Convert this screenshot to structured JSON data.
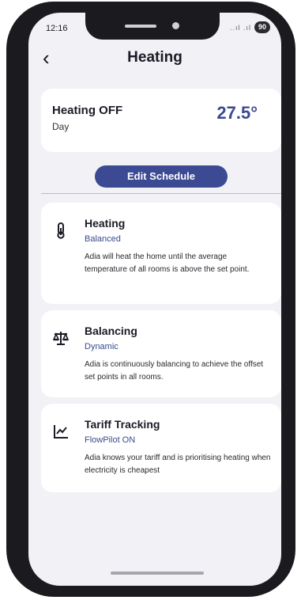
{
  "status_bar": {
    "time": "12:16",
    "signal": "..ıl .ıl",
    "battery": "90"
  },
  "header": {
    "back_glyph": "‹",
    "title": "Heating"
  },
  "summary": {
    "status": "Heating OFF",
    "mode": "Day",
    "temperature": "27.5°"
  },
  "edit_button": "Edit Schedule",
  "cards": [
    {
      "icon": "thermometer-icon",
      "title": "Heating",
      "subtitle": "Balanced",
      "description": "Adia will heat the home until the average temperature of all rooms is above the set point."
    },
    {
      "icon": "scale-icon",
      "title": "Balancing",
      "subtitle": "Dynamic",
      "description": "Adia is continuously balancing to achieve the offset set points in all rooms."
    },
    {
      "icon": "chart-line-icon",
      "title": "Tariff Tracking",
      "subtitle": "FlowPilot ON",
      "description": "Adia knows your tariff and is prioritising heating when electricity is cheapest"
    }
  ],
  "colors": {
    "accent": "#3b4a93",
    "temperature": "#3a4a8e",
    "background": "#f1f1f6"
  }
}
